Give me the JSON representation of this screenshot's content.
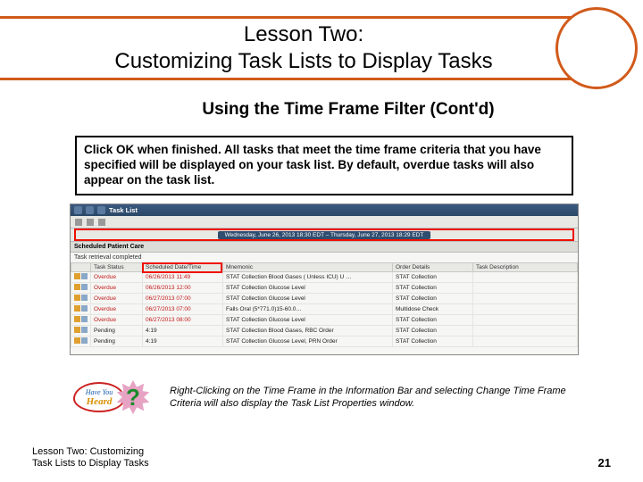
{
  "title_line1": "Lesson Two:",
  "title_line2": "Customizing Task Lists to Display Tasks",
  "subtitle": "Using the Time Frame Filter (Cont'd)",
  "instruction": "Click OK when finished. All tasks that meet the time frame criteria that you have specified will be displayed on your task list. By default, overdue tasks will also appear on the task list.",
  "screenshot": {
    "title": "Task List",
    "timefilter": "Wednesday, June 26, 2013 18:30 EDT – Thursday, June 27, 2013 18:29 EDT",
    "section": "Scheduled Patient Care",
    "subtext": "Task retrieval completed",
    "columns": [
      "",
      "Task Status",
      "Scheduled Date/Time",
      "Mnemonic",
      "Order Details",
      "Task Description"
    ],
    "rows": [
      {
        "status": "Overdue",
        "dt": "06/26/2013 11:49",
        "mnemonic": "STAT Collection Blood Gases ( Unless ICU) U …",
        "details": "STAT Collection",
        "desc": ""
      },
      {
        "status": "Overdue",
        "dt": "06/26/2013 12:00",
        "mnemonic": "STAT Collection Glucose Level",
        "details": "STAT Collection",
        "desc": ""
      },
      {
        "status": "Overdue",
        "dt": "06/27/2013 07:00",
        "mnemonic": "STAT Collection Glucose Level",
        "details": "STAT Collection",
        "desc": ""
      },
      {
        "status": "Overdue",
        "dt": "06/27/2013 07:00",
        "mnemonic": "Falls Oral (5*771.0)15-60.0…",
        "details": "Multidose Check",
        "desc": ""
      },
      {
        "status": "Overdue",
        "dt": "06/27/2013 08:00",
        "mnemonic": "STAT Collection Glucose Level",
        "details": "STAT Collection",
        "desc": ""
      },
      {
        "status": "Pending",
        "dt": "4:19",
        "mnemonic": "STAT Collection Blood Gases, RBC Order",
        "details": "STAT Collection",
        "desc": ""
      },
      {
        "status": "Pending",
        "dt": "4:19",
        "mnemonic": "STAT Collection Glucose Level, PRN Order",
        "details": "STAT Collection",
        "desc": ""
      }
    ]
  },
  "hyh": {
    "line1": "Have You",
    "line2": "Heard",
    "q": "?"
  },
  "tip": "Right-Clicking on the Time Frame in the Information Bar and selecting Change Time Frame Criteria will also display the Task List Properties window.",
  "footer_left_l1": "Lesson Two: Customizing",
  "footer_left_l2": "Task Lists to Display Tasks",
  "page_number": "21"
}
